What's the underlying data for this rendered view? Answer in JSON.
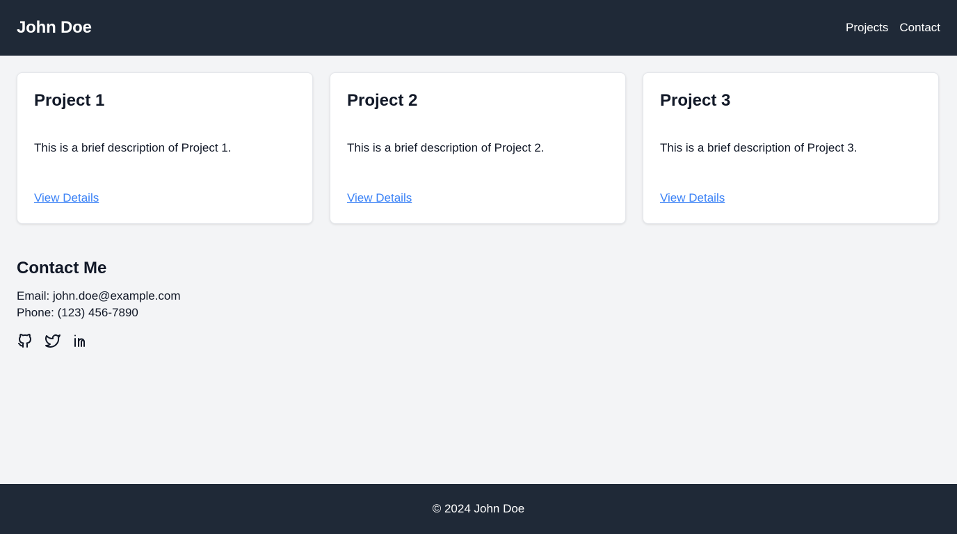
{
  "header": {
    "brand": "John Doe",
    "nav": [
      {
        "label": "Projects"
      },
      {
        "label": "Contact"
      }
    ]
  },
  "projects": [
    {
      "title": "Project 1",
      "description": "This is a brief description of Project 1.",
      "link_label": "View Details"
    },
    {
      "title": "Project 2",
      "description": "This is a brief description of Project 2.",
      "link_label": "View Details"
    },
    {
      "title": "Project 3",
      "description": "This is a brief description of Project 3.",
      "link_label": "View Details"
    }
  ],
  "contact": {
    "heading": "Contact Me",
    "email_line": "Email: john.doe@example.com",
    "phone_line": "Phone: (123) 456-7890",
    "socials": [
      {
        "icon": "github-icon"
      },
      {
        "icon": "twitter-icon"
      },
      {
        "icon": "linkedin-icon"
      }
    ]
  },
  "footer": {
    "copyright": "© 2024 John Doe"
  },
  "colors": {
    "header_bg": "#1f2937",
    "page_bg": "#f3f4f6",
    "link": "#3b82f6"
  }
}
